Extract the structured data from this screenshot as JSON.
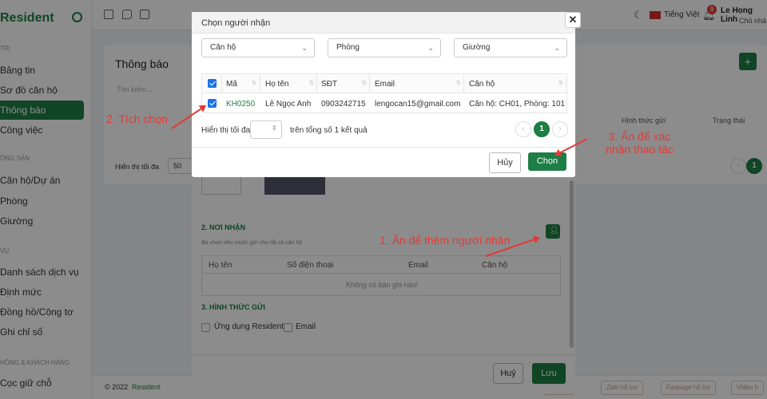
{
  "app": {
    "brand": "Resident",
    "sidebar_sections": [
      "TRỊ",
      "ỒNG SẢN",
      "VỤ",
      "HỒNG & KHÁCH HÀNG"
    ],
    "sidebar_items": [
      "Bảng tin",
      "Sơ đồ căn hộ",
      "Thông báo",
      "Công việc",
      "Căn hộ/Dự án",
      "Phòng",
      "Giường",
      "Danh sách dịch vụ",
      "Định mức",
      "Đồng hồ/Công tơ",
      "Ghi chỉ số",
      "Cọc giữ chỗ"
    ],
    "language": "Tiếng Việt",
    "notification_count": "9",
    "user_name": "Le Hong Linh",
    "user_role": "Chủ nhà",
    "footer_copyright": "© 2022",
    "footer_brand": "Resident",
    "footer_chips": [
      "0...955",
      "Zalo hỗ trợ",
      "Fanpage hỗ trợ",
      "Video h"
    ]
  },
  "page": {
    "title": "Thông báo",
    "search_placeholder": "Tìm kiếm...",
    "add_button": "+",
    "col_hinh_thuc": "Hình thức gửi",
    "col_trang_thai": "Trạng thái",
    "show_max": "Hiển thị tối đa",
    "show_max_value": "50",
    "page_current": "1"
  },
  "form": {
    "section2_title": "2. NƠI NHẬN",
    "section2_hint": "Bỏ chọn nếu muốn gửi cho tất cả căn hộ",
    "recipient_headers": [
      "Họ tên",
      "Số điện thoại",
      "Email",
      "Căn hộ"
    ],
    "empty_text": "Không có bản ghi nào!",
    "section3_title": "3. HÌNH THỨC GỬI",
    "opt_app": "Ứng dụng Resident",
    "opt_email": "Email",
    "cancel": "Huỷ",
    "save": "Lưu"
  },
  "modal": {
    "title": "Chọn người nhận",
    "close": "✕",
    "filter_apartment": "Căn hộ",
    "filter_room": "Phòng",
    "filter_bed": "Giường",
    "headers": [
      "Mã",
      "Họ tên",
      "SĐT",
      "Email",
      "Căn hộ"
    ],
    "rows": [
      {
        "code": "KH0250",
        "name": "Lê Ngọc Anh",
        "phone": "0903242715",
        "email": "lengocan15@gmail.com",
        "apartment": "Căn hộ: CH01, Phòng: 101",
        "checked": true
      }
    ],
    "show_max_label": "Hiển thị tối đa",
    "total_text": "trên tổng số 1 kết quả",
    "page_current": "1",
    "cancel": "Hủy",
    "choose": "Chọn"
  },
  "annotations": {
    "step1": "1. Ấn để thêm người nhận",
    "step2": "2. Tích chọn",
    "step3_line1": "3. Ấn để xác",
    "step3_line2": "nhận thao tác"
  },
  "colors": {
    "accent": "#1e7e45",
    "annotation": "#e53935",
    "checkbox": "#1a73e8"
  }
}
